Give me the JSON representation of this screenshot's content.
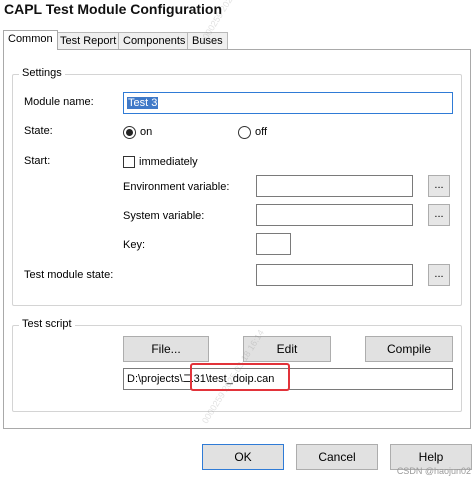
{
  "window": {
    "title": "CAPL Test Module Configuration"
  },
  "tabs": [
    {
      "label": "Common",
      "active": true
    },
    {
      "label": "Test Report",
      "active": false
    },
    {
      "label": "Components",
      "active": false
    },
    {
      "label": "Buses",
      "active": false
    }
  ],
  "settings": {
    "legend": "Settings",
    "module_name_label": "Module name:",
    "module_name_value": "Test 3",
    "state_label": "State:",
    "state_on_label": "on",
    "state_off_label": "off",
    "state_selected": "on",
    "start_label": "Start:",
    "immediately_label": "immediately",
    "immediately_checked": false,
    "env_var_label": "Environment variable:",
    "env_var_value": "",
    "sys_var_label": "System variable:",
    "sys_var_value": "",
    "key_label": "Key:",
    "key_value": "",
    "test_module_state_label": "Test module state:",
    "test_module_state_value": "",
    "browse_label": "..."
  },
  "test_script": {
    "legend": "Test script",
    "file_button": "File...",
    "edit_button": "Edit",
    "compile_button": "Compile",
    "path_value": "D:\\projects\\二31\\test_doip.can",
    "highlight_color": "#e2333a"
  },
  "footer": {
    "ok_label": "OK",
    "cancel_label": "Cancel",
    "help_label": "Help"
  },
  "watermark_text": "0000259 2025-03-18 16:14",
  "credit": "CSDN @haojun02"
}
